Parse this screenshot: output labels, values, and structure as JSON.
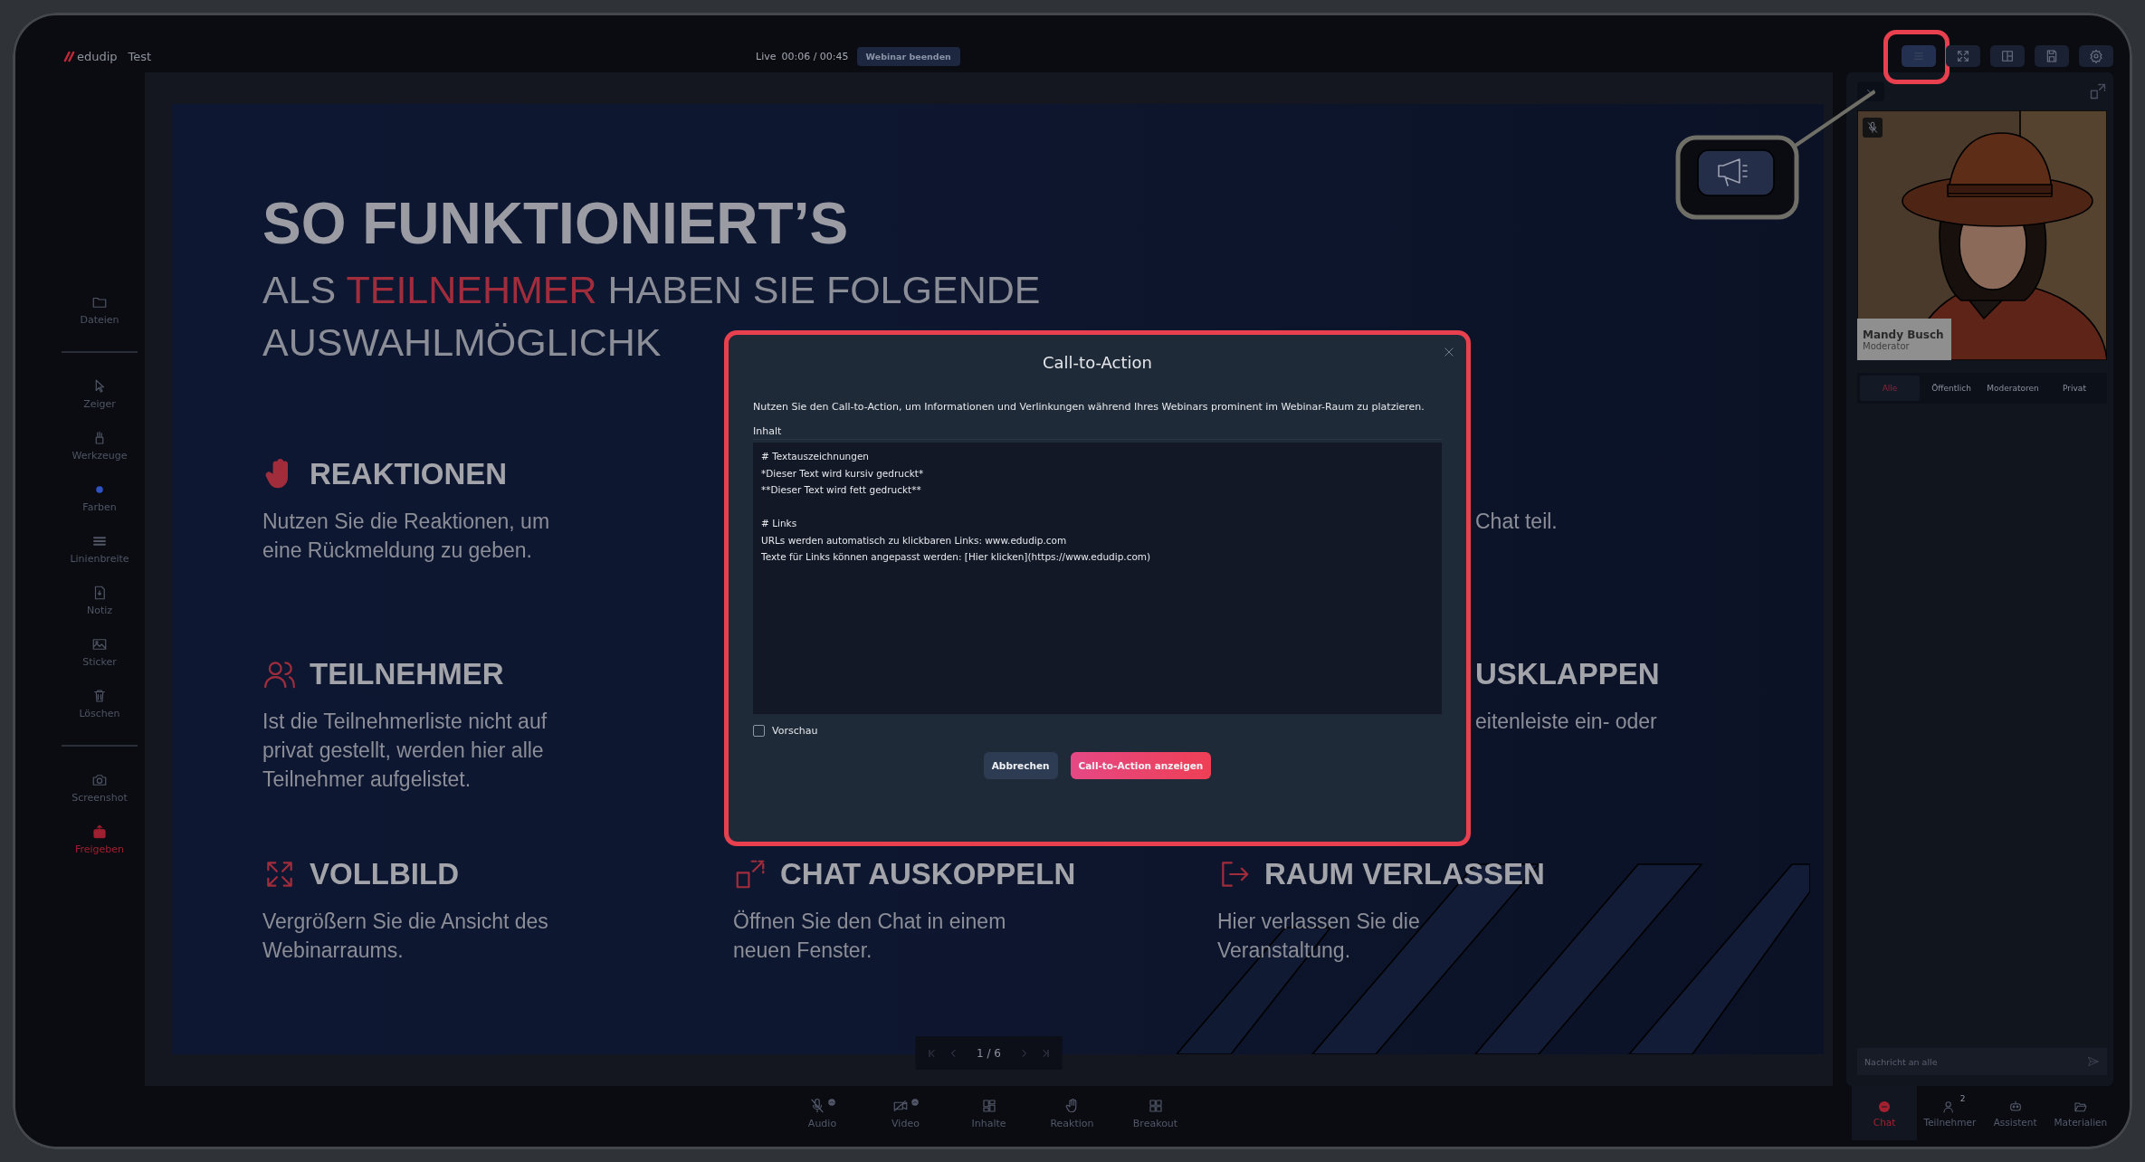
{
  "app": {
    "logo": "edudip",
    "title": "Test"
  },
  "session": {
    "status": "Live",
    "time": "00:06 / 00:45",
    "end_button": "Webinar beenden"
  },
  "top_actions": [
    {
      "highlighted": true
    },
    {
      "highlighted": false
    },
    {
      "highlighted": false
    },
    {
      "highlighted": false
    },
    {
      "highlighted": false
    }
  ],
  "sidebar": {
    "groups": [
      {
        "items": [
          {
            "label": "Dateien",
            "active": false
          }
        ]
      },
      {
        "items": [
          {
            "label": "Zeiger",
            "active": false
          },
          {
            "label": "Werkzeuge",
            "active": false
          },
          {
            "label": "Farben",
            "active": false
          },
          {
            "label": "Linienbreite",
            "active": false
          },
          {
            "label": "Notiz",
            "active": false
          },
          {
            "label": "Sticker",
            "active": false
          },
          {
            "label": "Löschen",
            "active": false
          }
        ]
      },
      {
        "items": [
          {
            "label": "Screenshot",
            "active": false
          },
          {
            "label": "Freigeben",
            "active": true
          }
        ]
      }
    ]
  },
  "slide": {
    "title": "SO FUNKTIONIERT’S",
    "subtitle": [
      {
        "lead": "ALS ",
        "accent": "TEILNEHMER",
        "rest": " HABEN SIE FOLGENDE"
      },
      {
        "lead": "AUSWAHLMÖGLICHK"
      }
    ],
    "rows": [
      {
        "items": [
          {
            "kind": "hand",
            "title": "REAKTIONEN",
            "text": "Nutzen Sie die Reaktionen, um eine Rückmeldung zu geben."
          },
          {
            "kind": "partial",
            "text": "Chat teil."
          }
        ]
      },
      {
        "items": [
          {
            "kind": "people",
            "title": "TEILNEHMER",
            "text": "Ist die Teilnehmerliste nicht auf privat gestellt, werden hier alle Teilnehmer aufgelistet."
          },
          {
            "kind": "partial",
            "title": "USKLAPPEN",
            "text": "eitenleiste ein- oder"
          }
        ]
      },
      {
        "items": [
          {
            "kind": "expand",
            "title": "VOLLBILD",
            "text": "Vergrößern Sie die Ansicht des Webinarraums."
          },
          {
            "kind": "popout",
            "title": "CHAT AUSKOPPELN",
            "text": "Öffnen Sie den Chat in einem neuen Fenster."
          },
          {
            "kind": "exit",
            "title": "RAUM VERLASSEN",
            "text": "Hier verlassen Sie die Veranstaltung."
          }
        ]
      }
    ],
    "pager": "1 / 6"
  },
  "toolbar": [
    {
      "label": "Audio",
      "menu": true
    },
    {
      "label": "Video",
      "menu": true
    },
    {
      "label": "Inhalte",
      "menu": false
    },
    {
      "label": "Reaktion",
      "menu": false
    },
    {
      "label": "Breakout",
      "menu": false
    }
  ],
  "video": {
    "name": "Mandy Busch",
    "role": "Moderator",
    "muted": true
  },
  "chat": {
    "tabs": [
      {
        "label": "Alle",
        "selected": true
      },
      {
        "label": "Öffentlich",
        "selected": false
      },
      {
        "label": "Moderatoren",
        "selected": false
      },
      {
        "label": "Privat",
        "selected": false
      }
    ],
    "placeholder": "Nachricht an alle"
  },
  "panel_tabs": [
    {
      "label": "Chat",
      "selected": true
    },
    {
      "label": "Teilnehmer",
      "selected": false,
      "badge": "2"
    },
    {
      "label": "Assistent",
      "selected": false
    },
    {
      "label": "Materialien",
      "selected": false
    }
  ],
  "modal": {
    "highlighted": true,
    "title": "Call-to-Action",
    "description": "Nutzen Sie den Call-to-Action, um Informationen und Verlinkungen während Ihres Webinars prominent im Webinar-Raum zu platzieren.",
    "field_label": "Inhalt",
    "content": "# Textauszeichnungen\n*Dieser Text wird kursiv gedruckt*\n**Dieser Text wird fett gedruckt**\n\n# Links\nURLs werden automatisch zu klickbaren Links: www.edudip.com\nTexte für Links können angepasst werden: [Hier klicken](https://www.edudip.com)",
    "preview": {
      "label": "Vorschau",
      "checked": false
    },
    "buttons": [
      {
        "label": "Abbrechen",
        "kind": "secondary"
      },
      {
        "label": "Call-to-Action anzeigen",
        "kind": "primary"
      }
    ]
  }
}
